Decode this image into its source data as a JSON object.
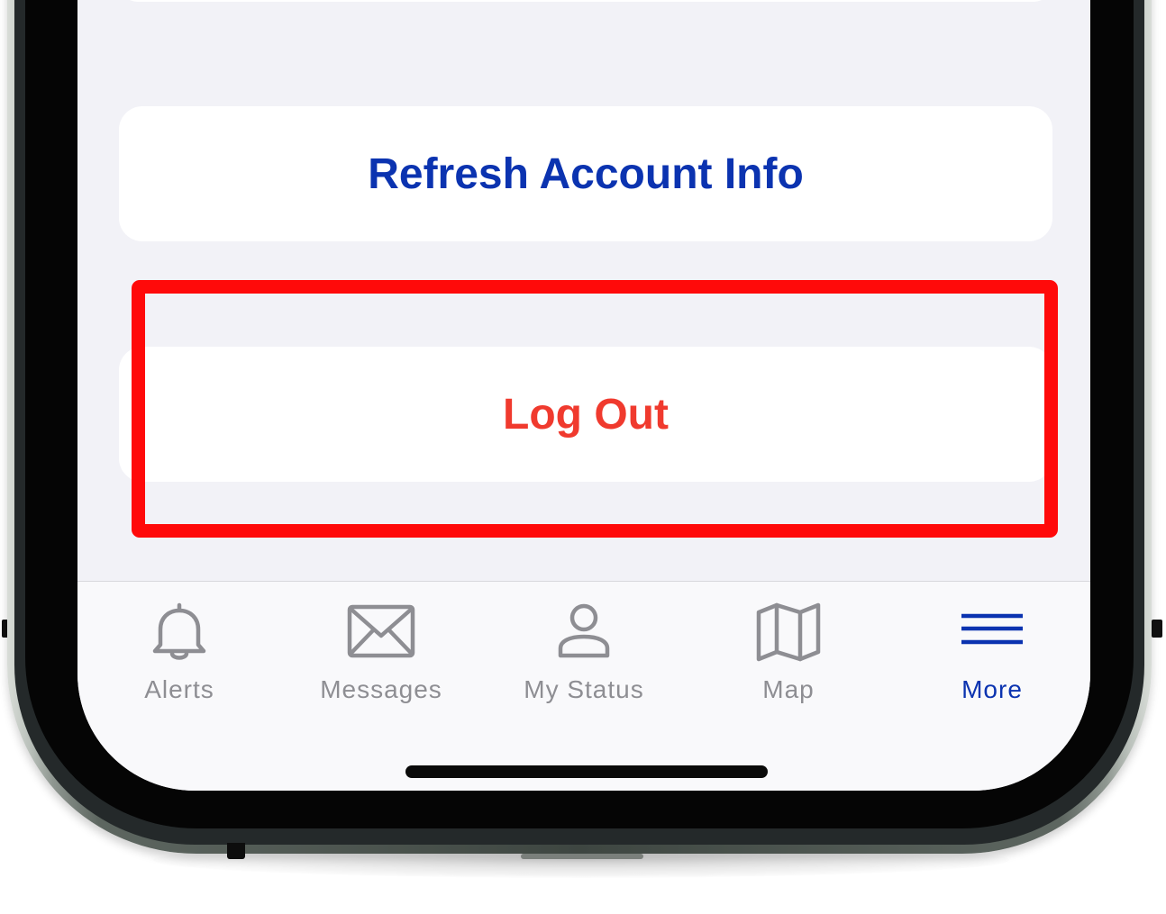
{
  "buttons": {
    "refresh_account_info": "Refresh Account Info",
    "log_out": "Log Out"
  },
  "tab_bar": {
    "tabs": [
      {
        "label": "Alerts",
        "icon": "bell-icon",
        "active": false
      },
      {
        "label": "Messages",
        "icon": "envelope-icon",
        "active": false
      },
      {
        "label": "My Status",
        "icon": "person-icon",
        "active": false
      },
      {
        "label": "Map",
        "icon": "map-icon",
        "active": false
      },
      {
        "label": "More",
        "icon": "menu-icon",
        "active": true
      }
    ]
  },
  "colors": {
    "accent": "#0B33B0",
    "destructive": "#F03A2E",
    "highlight": "#FF0A0A",
    "inactive_tab": "#8E8E93",
    "background": "#F2F2F7"
  }
}
